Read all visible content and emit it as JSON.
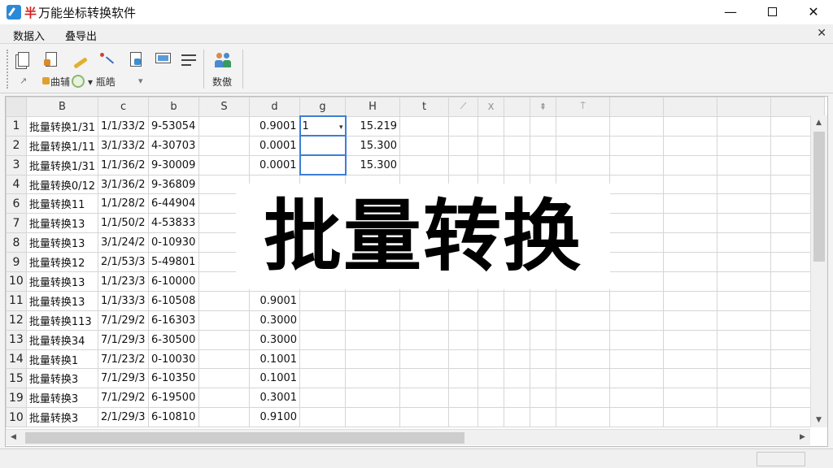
{
  "window": {
    "title": "万能坐标转换软件",
    "logo_glyph": "半",
    "minimize": "—",
    "close": "✕"
  },
  "menu": {
    "items": [
      "数据入",
      "叠导出"
    ],
    "close": "✕"
  },
  "toolbar": {
    "icons": [
      "copy-icon",
      "paste-icon",
      "edit-icon",
      "transform-icon",
      "export-icon",
      "monitor-icon",
      "settings-icon",
      "users-icon"
    ],
    "row2": {
      "cursor": "↗",
      "field1": "曲辅",
      "field2": "▾ 瓶皓",
      "dropdown": "▾"
    },
    "group_label": "数傲"
  },
  "grid": {
    "columns": [
      "B",
      "c",
      "b",
      "S",
      "d",
      "g",
      "H",
      "t",
      "",
      "X",
      "",
      "",
      "",
      "",
      "",
      "",
      ""
    ],
    "ghost_headers": [
      "⟋",
      "X",
      "⇞",
      "⍑"
    ],
    "rows": [
      {
        "num": "1",
        "cells": [
          "批量转换1/31",
          "1/1/33/2",
          "9-53054",
          "",
          "0.9001",
          "1",
          "15.219"
        ]
      },
      {
        "num": "2",
        "cells": [
          "批量转换1/11",
          "3/1/33/2",
          "4-30703",
          "",
          "0.0001",
          "",
          "15.300"
        ]
      },
      {
        "num": "3",
        "cells": [
          "批量转换1/31",
          "1/1/36/2",
          "9-30009",
          "",
          "0.0001",
          "",
          "15.300"
        ]
      },
      {
        "num": "4",
        "cells": [
          "批量转换0/12",
          "3/1/36/2",
          "9-36809",
          "",
          "",
          "",
          ""
        ]
      },
      {
        "num": "6",
        "cells": [
          "批量转换11",
          "1/1/28/2",
          "6-44904",
          "",
          "",
          "",
          ""
        ]
      },
      {
        "num": "7",
        "cells": [
          "批量转换13",
          "1/1/50/2",
          "4-53833",
          "",
          "",
          "",
          ""
        ]
      },
      {
        "num": "8",
        "cells": [
          "批量转换13",
          "3/1/24/2",
          "0-10930",
          "",
          "",
          "",
          ""
        ]
      },
      {
        "num": "9",
        "cells": [
          "批量转换12",
          "2/1/53/3",
          "5-49801",
          "",
          "",
          "",
          ""
        ]
      },
      {
        "num": "10",
        "cells": [
          "批量转换13",
          "1/1/23/3",
          "6-10000",
          "",
          "",
          "",
          ""
        ]
      },
      {
        "num": "11",
        "cells": [
          "批量转换13",
          "1/1/33/3",
          "6-10508",
          "",
          "0.9001",
          "",
          ""
        ]
      },
      {
        "num": "12",
        "cells": [
          "批量转换113",
          "7/1/29/2",
          "6-16303",
          "",
          "0.3000",
          "",
          ""
        ]
      },
      {
        "num": "13",
        "cells": [
          "批量转换34",
          "7/1/29/3",
          "6-30500",
          "",
          "0.3000",
          "",
          ""
        ]
      },
      {
        "num": "14",
        "cells": [
          "批量转换1",
          "7/1/23/2",
          "0-10030",
          "",
          "0.1001",
          "",
          ""
        ]
      },
      {
        "num": "15",
        "cells": [
          "批量转换3",
          "7/1/29/3",
          "6-10350",
          "",
          "0.1001",
          "",
          ""
        ]
      },
      {
        "num": "19",
        "cells": [
          "批量转换3",
          "7/1/29/2",
          "6-19500",
          "",
          "0.3001",
          "",
          ""
        ]
      },
      {
        "num": "10",
        "cells": [
          "批量转换3",
          "2/1/29/3",
          "6-10810",
          "",
          "0.9100",
          "",
          ""
        ]
      }
    ]
  },
  "overlay": {
    "text": "批量转换"
  },
  "colors": {
    "accent": "#3c7fd6",
    "logo": "#d42020"
  }
}
